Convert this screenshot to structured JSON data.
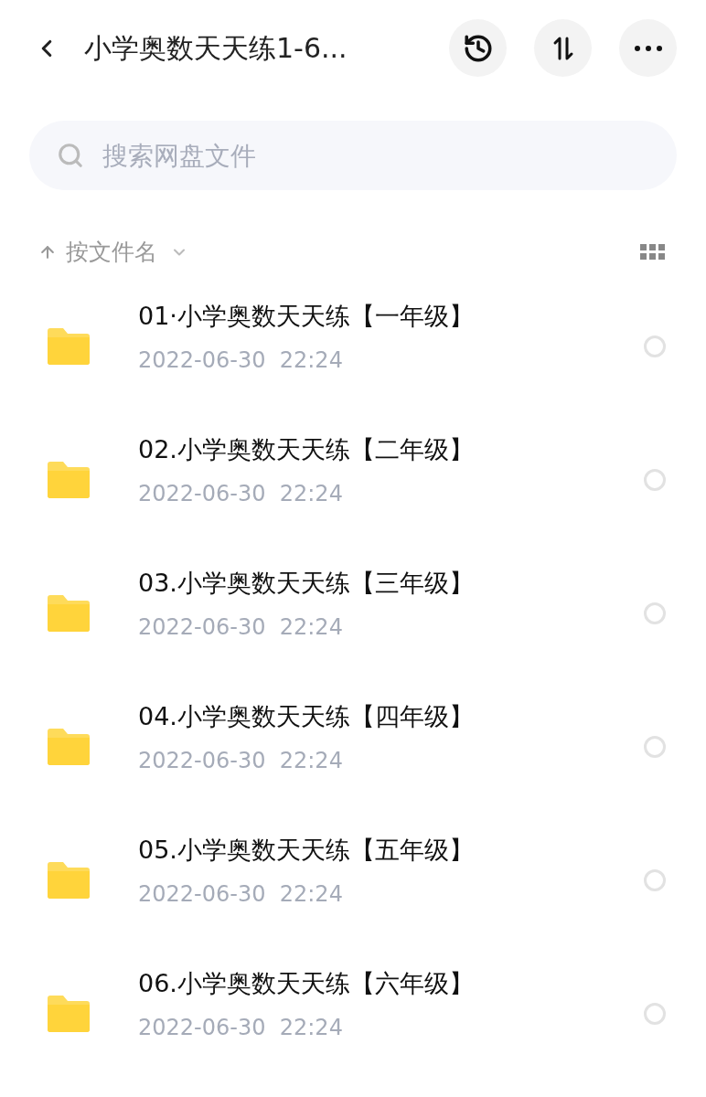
{
  "header": {
    "title": "小学奥数天天练1-6..."
  },
  "search": {
    "placeholder": "搜索网盘文件"
  },
  "sort": {
    "label": "按文件名"
  },
  "files": [
    {
      "name": "01·小学奥数天天练【一年级】",
      "date": "2022-06-30  22:24",
      "selected": false
    },
    {
      "name": "02.小学奥数天天练【二年级】",
      "date": "2022-06-30  22:24",
      "selected": false
    },
    {
      "name": "03.小学奥数天天练【三年级】",
      "date": "2022-06-30  22:24",
      "selected": false
    },
    {
      "name": "04.小学奥数天天练【四年级】",
      "date": "2022-06-30  22:24",
      "selected": false
    },
    {
      "name": "05.小学奥数天天练【五年级】",
      "date": "2022-06-30  22:24",
      "selected": false
    },
    {
      "name": "06.小学奥数天天练【六年级】",
      "date": "2022-06-30  22:24",
      "selected": false
    }
  ]
}
